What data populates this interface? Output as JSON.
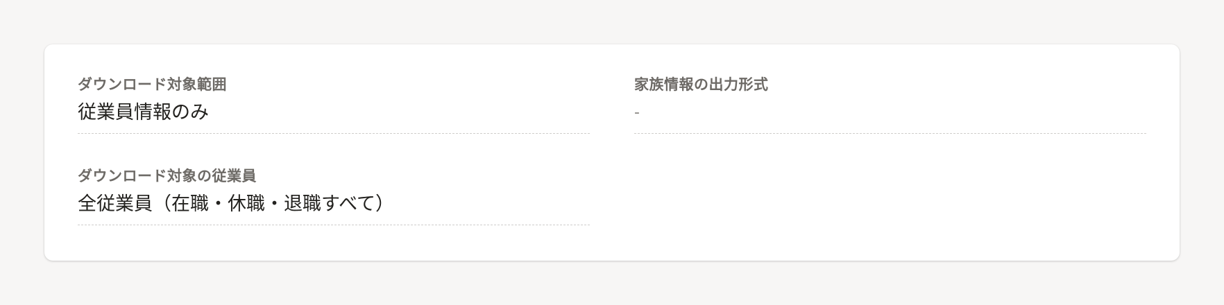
{
  "fields": [
    {
      "label": "ダウンロード対象範囲",
      "value": "従業員情報のみ"
    },
    {
      "label": "家族情報の出力形式",
      "value": "-"
    },
    {
      "label": "ダウンロード対象の従業員",
      "value": "全従業員（在職・休職・退職すべて）"
    }
  ]
}
